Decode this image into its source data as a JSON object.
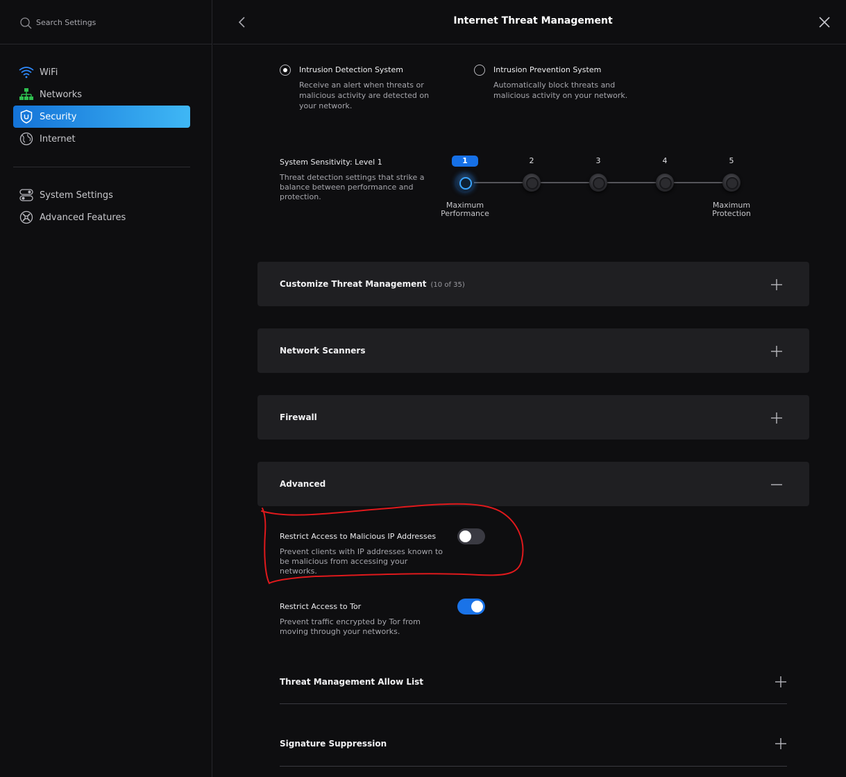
{
  "sidebar": {
    "search": {
      "placeholder": "Search Settings"
    },
    "items": [
      {
        "label": "WiFi",
        "icon": "wifi-icon"
      },
      {
        "label": "Networks",
        "icon": "network-topology-icon"
      },
      {
        "label": "Security",
        "icon": "shield-icon",
        "active": true
      },
      {
        "label": "Internet",
        "icon": "globe-icon"
      }
    ],
    "items2": [
      {
        "label": "System Settings",
        "icon": "toggle-settings-icon"
      },
      {
        "label": "Advanced Features",
        "icon": "tools-icon"
      }
    ]
  },
  "header": {
    "title": "Internet Threat Management"
  },
  "mode": {
    "selected": "ids",
    "ids": {
      "title": "Intrusion Detection System",
      "desc": "Receive an alert when threats or malicious activity are detected on your network."
    },
    "ips": {
      "title": "Intrusion Prevention System",
      "desc": "Automatically block threats and malicious activity on your network."
    }
  },
  "sensitivity": {
    "title": "System Sensitivity: Level 1",
    "desc": "Threat detection settings that strike a balance between performance and protection.",
    "levels": [
      "1",
      "2",
      "3",
      "4",
      "5"
    ],
    "selected_level": 1,
    "min_label": "Maximum Performance",
    "max_label": "Maximum Protection"
  },
  "sections": {
    "customize": {
      "title": "Customize Threat Management",
      "count": "(10 of 35)"
    },
    "scanners": {
      "title": "Network Scanners"
    },
    "firewall": {
      "title": "Firewall"
    },
    "advanced": {
      "title": "Advanced",
      "expanded": true
    }
  },
  "advanced": {
    "malicious_ip": {
      "title": "Restrict Access to Malicious IP Addresses",
      "desc": "Prevent clients with IP addresses known to be malicious from accessing your networks.",
      "enabled": false
    },
    "tor": {
      "title": "Restrict Access to Tor",
      "desc": "Prevent traffic encrypted by Tor from moving through your networks.",
      "enabled": true
    },
    "allow_list": {
      "title": "Threat Management Allow List"
    },
    "suppression": {
      "title": "Signature Suppression"
    }
  },
  "colors": {
    "accent": "#1a73e8",
    "active_gradient_end": "#3fb7f5",
    "annotation": "#e0191c"
  }
}
